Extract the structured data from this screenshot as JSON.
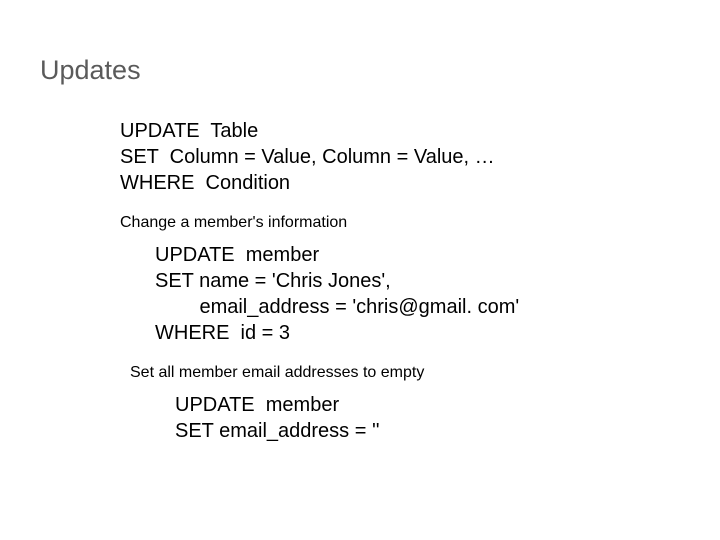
{
  "title": "Updates",
  "syntax": {
    "line1": "UPDATE  Table",
    "line2": "SET  Column = Value, Column = Value, …",
    "line3": "WHERE  Condition"
  },
  "example1": {
    "label": "Change a member's information",
    "line1": "UPDATE  member",
    "line2": "SET name = 'Chris Jones',",
    "line3": "        email_address = 'chris@gmail. com'",
    "line4": "WHERE  id = 3"
  },
  "example2": {
    "label": "Set all member email addresses to empty",
    "line1": "UPDATE  member",
    "line2": "SET email_address = ''"
  }
}
